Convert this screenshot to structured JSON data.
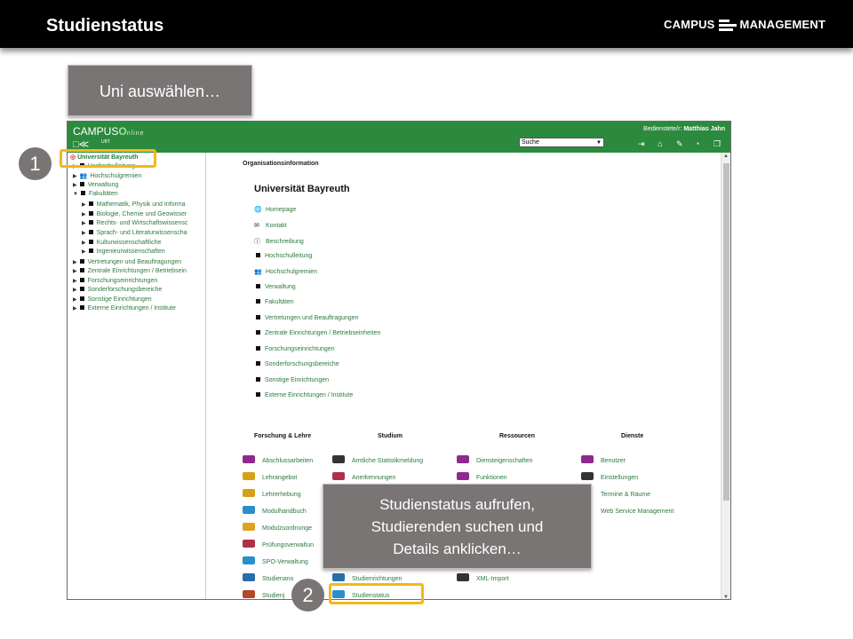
{
  "slide": {
    "title": "Studienstatus",
    "brand": {
      "left": "CAMPUS",
      "right": "MANAGEMENT"
    }
  },
  "callouts": {
    "top": "Uni auswählen…",
    "middle_lines": [
      "Studienstatus aufrufen,",
      "Studierenden suchen und",
      "Details anklicken…"
    ]
  },
  "badges": [
    "1",
    "2"
  ],
  "app": {
    "logo_main": "CAMPUS",
    "logo_online": "nline",
    "logo_o": "O",
    "logo_sub": "UBT",
    "user_prefix": "Bedienstete/r:",
    "user_name": "Matthias Jahn",
    "search_value": "Suche",
    "header_icons": [
      "logout-icon",
      "home-icon",
      "edit-icon",
      "dashboard-icon",
      "copy-icon"
    ]
  },
  "tree": {
    "root": "Universität Bayreuth",
    "items": [
      "Hochschulleitung",
      "Hochschulgremien",
      "Verwaltung",
      "Fakultäten",
      "Mathematik, Physik und Informa",
      "Biologie, Chemie und Geowisser",
      "Rechts- und Wirtschaftswissensc",
      "Sprach- und Literaturwissenscha",
      "Kulturwissenschaftliche",
      "Ingenieurwissenschaften",
      "Vertretungen und Beauftragungen",
      "Zentrale Einrichtungen / Betriebsein",
      "Forschungseinrichtungen",
      "Sonderforschungsbereiche",
      "Sonstige Einrichtungen",
      "Externe Einrichtungen / Institute"
    ]
  },
  "content": {
    "section": "Organisationsinformation",
    "title": "Universität Bayreuth",
    "links": [
      {
        "label": "Homepage",
        "icon": "globe-icon"
      },
      {
        "label": "Kontakt",
        "icon": "envelope-icon"
      },
      {
        "label": "Beschreibung",
        "icon": "info-icon"
      },
      {
        "label": "Hochschulleitung",
        "icon": "square-icon"
      },
      {
        "label": "Hochschulgremien",
        "icon": "group-icon"
      },
      {
        "label": "Verwaltung",
        "icon": "square-icon"
      },
      {
        "label": "Fakultäten",
        "icon": "square-icon"
      },
      {
        "label": "Vertretungen und Beauftragungen",
        "icon": "square-icon"
      },
      {
        "label": "Zentrale Einrichtungen / Betriebseinheiten",
        "icon": "square-icon"
      },
      {
        "label": "Forschungseinrichtungen",
        "icon": "square-icon"
      },
      {
        "label": "Sonderforschungsbereiche",
        "icon": "square-icon"
      },
      {
        "label": "Sonstige Einrichtungen",
        "icon": "square-icon"
      },
      {
        "label": "Externe Einrichtungen / Institute",
        "icon": "square-icon"
      }
    ],
    "columns": [
      {
        "heading": "Forschung & Lehre",
        "items": [
          {
            "label": "Abschlussarbeiten",
            "color": "#8e2a8e"
          },
          {
            "label": "Lehrangebot",
            "color": "#d4a017"
          },
          {
            "label": "Lehrerhebung",
            "color": "#d4a017"
          },
          {
            "label": "Modulhandbuch",
            "color": "#2a8ec9"
          },
          {
            "label": "Modulzuordnunge",
            "color": "#e0a020"
          },
          {
            "label": "Prüfungsverwaltun",
            "color": "#b0304a"
          },
          {
            "label": "SPO-Verwaltung",
            "color": "#2a8ec9"
          },
          {
            "label": "Studienano",
            "color": "#2a6ea9"
          },
          {
            "label": "Studienj",
            "color": "#b04a2a"
          }
        ]
      },
      {
        "heading": "Studium",
        "items": [
          {
            "label": "Amtliche Statistikmeldung",
            "color": "#333333"
          },
          {
            "label": "Anerkennungen",
            "color": "#b0304a"
          },
          {
            "label": "Studienrichtungen",
            "color": "#2a6ea9"
          },
          {
            "label": "Studienstatus",
            "color": "#2a8ec9"
          }
        ]
      },
      {
        "heading": "Ressourcen",
        "items": [
          {
            "label": "Diensteigenschaften",
            "color": "#8e2a8e"
          },
          {
            "label": "Funktionen",
            "color": "#8e2a8e"
          },
          {
            "label": "XML-Import",
            "color": "#333333"
          }
        ]
      },
      {
        "heading": "Dienste",
        "items": [
          {
            "label": "Benutzer",
            "color": "#8e2a8e"
          },
          {
            "label": "Einstellungen",
            "color": "#333333"
          },
          {
            "label": "Termine & Räume",
            "color": "#ffffff"
          },
          {
            "label": "Web Service Management",
            "color": "#ffffff"
          }
        ]
      }
    ]
  }
}
